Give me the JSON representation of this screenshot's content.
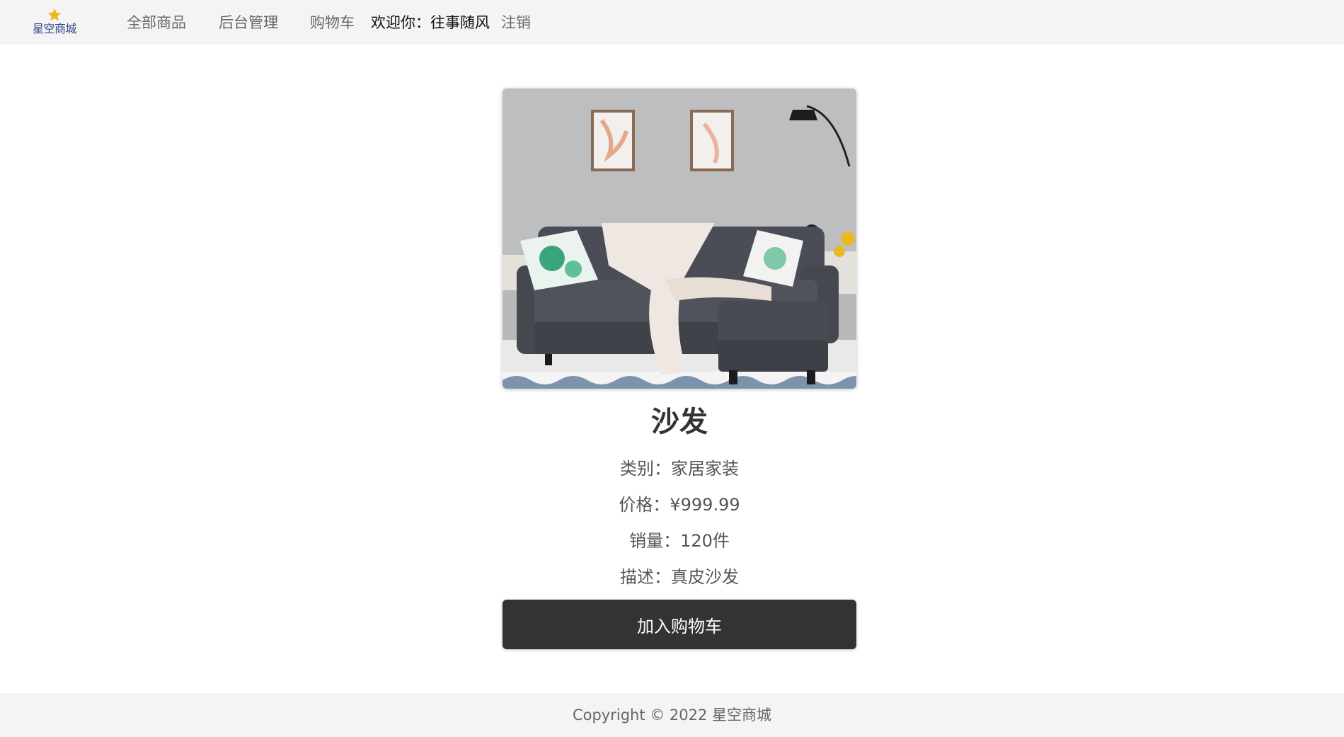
{
  "brand": {
    "name": "星空商城",
    "logo_icon": "star-icon",
    "star_color": "#f5b21a",
    "text_color": "#2f4a86"
  },
  "nav": {
    "all_products": "全部商品",
    "admin": "后台管理",
    "cart": "购物车",
    "welcome": "欢迎你：往事随风",
    "logout": "注销"
  },
  "product": {
    "image_alt": "sofa-photo",
    "name": "沙发",
    "category": "类别：家居家装",
    "price": "价格：¥999.99",
    "sales": "销量：120件",
    "description": "描述：真皮沙发",
    "add_to_cart": "加入购物车"
  },
  "footer": {
    "copyright": "Copyright © 2022 星空商城"
  },
  "colors": {
    "navbar_bg": "#f4f4f4",
    "button_bg": "#333333",
    "button_text": "#ffffff"
  }
}
